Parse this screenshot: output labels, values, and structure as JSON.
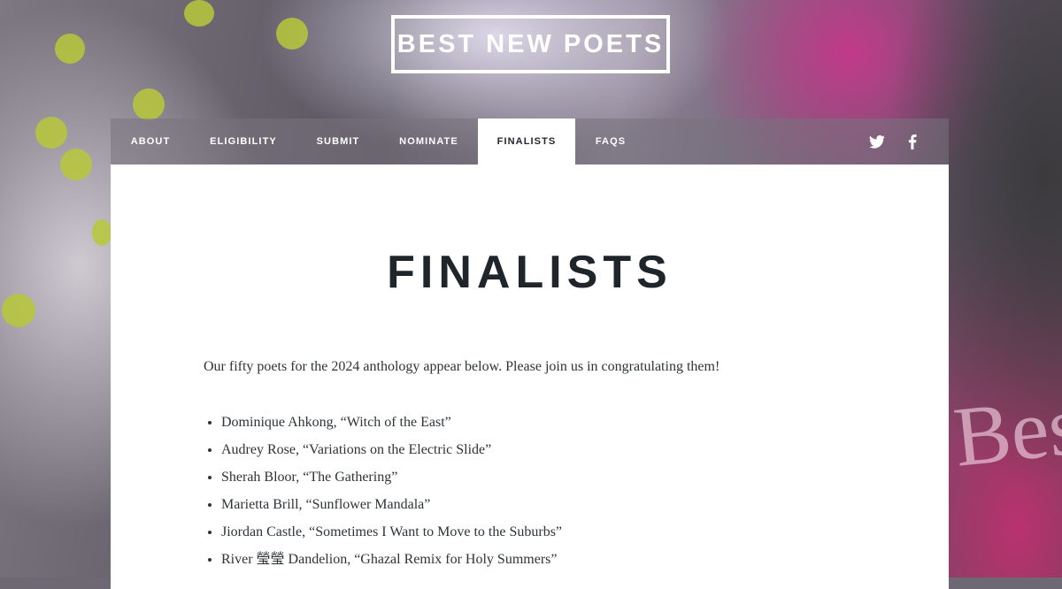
{
  "site": {
    "logo": "BEST NEW POETS"
  },
  "nav": {
    "items": [
      {
        "label": "ABOUT"
      },
      {
        "label": "ELIGIBILITY"
      },
      {
        "label": "SUBMIT"
      },
      {
        "label": "NOMINATE"
      },
      {
        "label": "FINALISTS",
        "active": true
      },
      {
        "label": "FAQS"
      }
    ],
    "social": [
      "twitter-icon",
      "facebook-icon"
    ]
  },
  "page": {
    "title": "FINALISTS",
    "intro": "Our fifty poets for the 2024 anthology appear below. Please join us in congratulating them!",
    "finalists": [
      "Dominique Ahkong, “Witch of the East”",
      "Audrey Rose, “Variations on the Electric Slide”",
      "Sherah Bloor, “The Gathering”",
      "Marietta Brill, “Sunflower Mandala”",
      "Jiordan Castle, “Sometimes I Want to Move to the Suburbs”",
      "River 瑩瑩 Dandelion, “Ghazal Remix for Holy Summers”"
    ]
  },
  "colors": {
    "accent_text": "#1f262b",
    "nav_overlay": "#78737d",
    "card": "#ffffff"
  }
}
